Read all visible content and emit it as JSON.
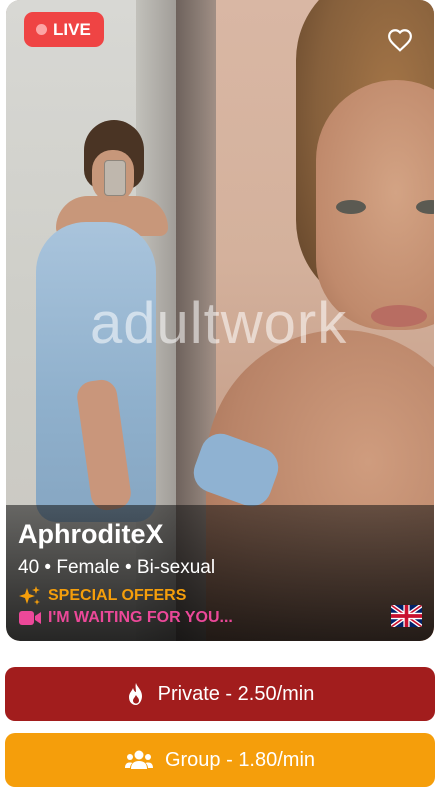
{
  "card": {
    "live_label": "LIVE",
    "watermark": "adultwork",
    "name": "AphroditeX",
    "meta": "40 • Female • Bi-sexual",
    "offer_label": "SPECIAL OFFERS",
    "status_text": "I'M WAITING FOR YOU...",
    "flag_icon": "uk-flag-icon",
    "colors": {
      "live": "#ef4444",
      "offer": "#f59e0b",
      "status": "#ec4899"
    }
  },
  "actions": {
    "private_label": "Private - 2.50/min",
    "group_label": "Group - 1.80/min",
    "private_color": "#a21d1d",
    "group_color": "#f59e0b"
  }
}
